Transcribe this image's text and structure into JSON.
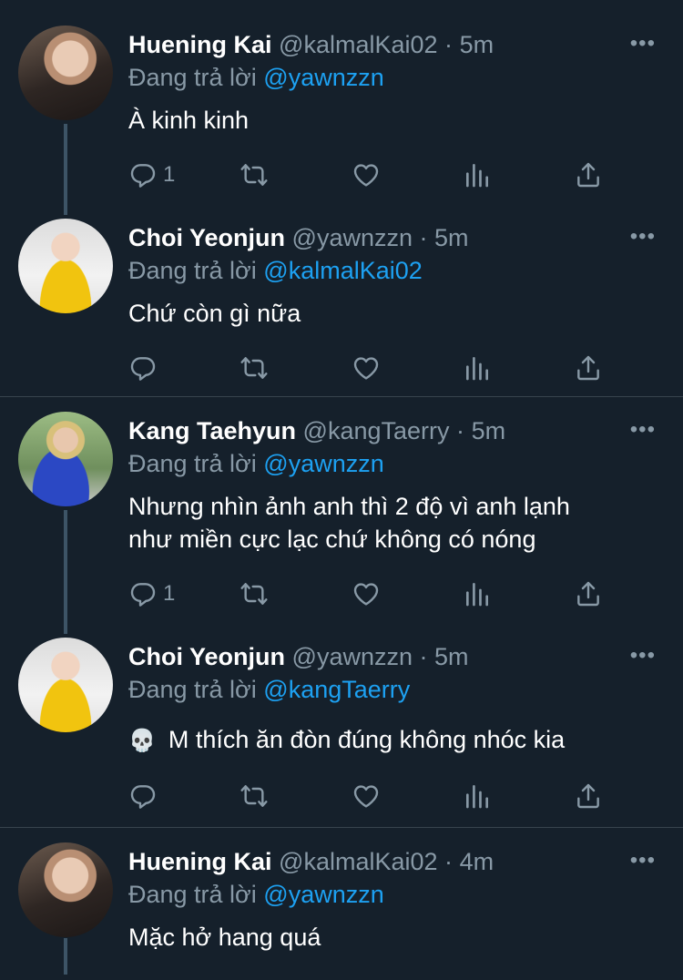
{
  "tweets": [
    {
      "name": "Huening Kai",
      "handle": "@kalmalKai02",
      "dot": "·",
      "time": "5m",
      "reply_prefix": "Đang trả lời",
      "reply_to": "@yawnzzn",
      "text": "À kinh kinh",
      "reply_count": "1",
      "avatar": "avatar-huening-kai"
    },
    {
      "name": "Choi Yeonjun",
      "handle": "@yawnzzn",
      "dot": "·",
      "time": "5m",
      "reply_prefix": "Đang trả lời",
      "reply_to": "@kalmalKai02",
      "text": "Chứ còn gì nữa",
      "reply_count": "",
      "avatar": "avatar-choi-yeonjun"
    },
    {
      "name": "Kang Taehyun",
      "handle": "@kangTaerry",
      "dot": "·",
      "time": "5m",
      "reply_prefix": "Đang trả lời",
      "reply_to": "@yawnzzn",
      "text_line1": "Nhưng nhìn ảnh anh thì 2 độ vì anh lạnh",
      "text_line2": "như miền cực lạc chứ không có nóng",
      "reply_count": "1",
      "avatar": "avatar-kang-taehyun"
    },
    {
      "name": "Choi Yeonjun",
      "handle": "@yawnzzn",
      "dot": "·",
      "time": "5m",
      "reply_prefix": "Đang trả lời",
      "reply_to": "@kangTaerry",
      "emoji": "💀",
      "text": "M thích ăn đòn đúng không nhóc kia",
      "reply_count": "",
      "avatar": "avatar-choi-yeonjun"
    },
    {
      "name": "Huening Kai",
      "handle": "@kalmalKai02",
      "dot": "·",
      "time": "4m",
      "reply_prefix": "Đang trả lời",
      "reply_to": "@yawnzzn",
      "text": "Mặc hở hang quá",
      "avatar": "avatar-huening-kai"
    }
  ],
  "more_label": "•••",
  "icons": [
    "reply-icon",
    "retweet-icon",
    "like-icon",
    "analytics-icon",
    "share-icon"
  ],
  "colors": {
    "background": "#15202b",
    "secondary_text": "#8899a6",
    "mention": "#1da1f2",
    "divider": "#38444d"
  }
}
